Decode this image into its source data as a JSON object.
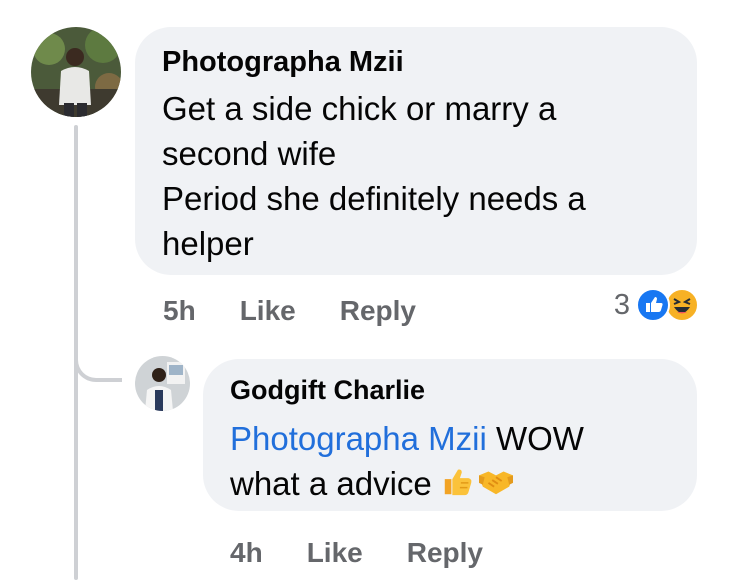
{
  "comment1": {
    "author": "Photographa Mzii",
    "lines": [
      "Get a side chick or marry a",
      "second wife",
      "Period she definitely needs a",
      "helper"
    ],
    "time": "5h",
    "like_label": "Like",
    "reply_label": "Reply",
    "reaction_count": "3",
    "reactions": [
      "like-icon",
      "haha-icon"
    ]
  },
  "comment2": {
    "author": "Godgift Charlie",
    "mention": "Photographa Mzii",
    "text_after_mention": " WOW",
    "line2": "what a advice ",
    "emojis": [
      "thumbs-up-emoji",
      "handshake-emoji"
    ],
    "time": "4h",
    "like_label": "Like",
    "reply_label": "Reply"
  },
  "colors": {
    "bubble": "#f0f2f5",
    "mention": "#216fdb",
    "meta": "#65676b",
    "thread_line": "#ced0d4",
    "like_blue": "#1877f2",
    "haha_yellow": "#f7b125"
  }
}
